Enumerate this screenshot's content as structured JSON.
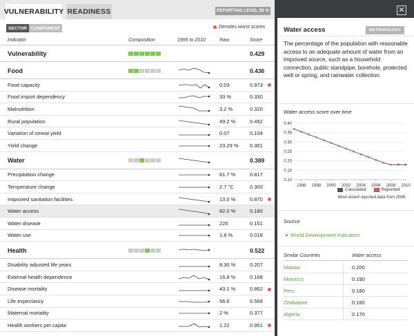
{
  "tabs": {
    "vulnerability": "VULNERABILITY",
    "readiness": "READINESS"
  },
  "reporting_badge": "REPORTING LEVEL 58 %",
  "toggles": {
    "sector": "SECTOR",
    "component": "COMPONENT"
  },
  "worst_note": "Denotes worst scores",
  "columns": {
    "indicator": "Indicator",
    "composition": "Composition",
    "period": "1995 to 2010",
    "raw": "Raw",
    "score": "Score"
  },
  "rows": [
    {
      "name": "Vulnerability",
      "type": "top",
      "raw": "",
      "score": "0.429",
      "comp": [
        1,
        1,
        1,
        1,
        1,
        1
      ],
      "spark": [],
      "worst": false
    },
    {
      "name": "Food",
      "type": "group",
      "raw": "",
      "score": "0.436",
      "comp": [
        1,
        1,
        0,
        0,
        0,
        0
      ],
      "spark": [
        6,
        4,
        6,
        3,
        5,
        9,
        10
      ],
      "worst": false
    },
    {
      "name": "Food capacity",
      "type": "item",
      "raw": "0.03",
      "score": "0.973",
      "comp": [],
      "spark": [
        7,
        6,
        6,
        7,
        6,
        11,
        6,
        10
      ],
      "worst": true
    },
    {
      "name": "Food import dependency",
      "type": "item",
      "raw": "33 %",
      "score": "0.330",
      "comp": [],
      "spark": [
        8,
        8,
        6,
        5,
        8,
        6,
        6
      ],
      "worst": false
    },
    {
      "name": "Malnutrition",
      "type": "item",
      "raw": "3.2 %",
      "score": "0.320",
      "comp": [],
      "spark": [
        2,
        3,
        4,
        5,
        9,
        9,
        9
      ],
      "worst": false
    },
    {
      "name": "Rural population",
      "type": "item",
      "raw": "49.2 %",
      "score": "0.492",
      "comp": [],
      "spark": [
        5,
        6,
        7,
        8,
        9,
        10,
        11
      ],
      "worst": false
    },
    {
      "name": "Variation of cereal yield",
      "type": "item",
      "raw": "0.07",
      "score": "0.104",
      "comp": [],
      "spark": [
        9,
        9,
        9,
        9,
        9,
        9,
        9
      ],
      "worst": false
    },
    {
      "name": "Yield change",
      "type": "item",
      "raw": "23.29 %",
      "score": "0.361",
      "comp": [],
      "spark": [
        7,
        7,
        7,
        7,
        7,
        7,
        7
      ],
      "worst": false
    },
    {
      "name": "Water",
      "type": "group",
      "raw": "",
      "score": "0.389",
      "comp": [
        0,
        0,
        1,
        0,
        0,
        0
      ],
      "spark": [
        4,
        5,
        6,
        7,
        8,
        9,
        10
      ],
      "worst": false
    },
    {
      "name": "Precipitation change",
      "type": "item",
      "raw": "81.7 %",
      "score": "0.817",
      "comp": [],
      "spark": [
        7,
        7,
        7,
        7,
        7,
        7,
        7
      ],
      "worst": false
    },
    {
      "name": "Temperature change",
      "type": "item",
      "raw": "2.7 °C",
      "score": "0.300",
      "comp": [],
      "spark": [
        7,
        7,
        7,
        7,
        7,
        7,
        7
      ],
      "worst": false
    },
    {
      "name": "Improved sanitation facilities",
      "type": "item",
      "raw": "13.0 %",
      "score": "0.870",
      "comp": [],
      "spark": [
        4,
        5,
        6,
        7,
        8,
        9,
        10
      ],
      "worst": true
    },
    {
      "name": "Water access",
      "type": "item",
      "raw": "82.0 %",
      "score": "0.180",
      "comp": [],
      "spark": [
        4,
        5,
        6,
        7,
        8,
        9,
        11
      ],
      "worst": false,
      "highlight": true
    },
    {
      "name": "Water disease",
      "type": "item",
      "raw": "226",
      "score": "0.151",
      "comp": [],
      "spark": [
        9,
        9,
        9,
        9,
        9,
        9,
        9
      ],
      "worst": false
    },
    {
      "name": "Water use",
      "type": "item",
      "raw": "1.8 %",
      "score": "0.018",
      "comp": [],
      "spark": [
        7,
        7,
        7,
        7,
        7,
        7,
        7
      ],
      "worst": false
    },
    {
      "name": "Health",
      "type": "group",
      "raw": "",
      "score": "0.522",
      "comp": [
        0,
        0,
        0,
        1,
        0,
        0
      ],
      "spark": [
        6,
        5,
        6,
        5,
        6,
        7,
        6
      ],
      "worst": false
    },
    {
      "name": "Disability adjusted life years",
      "type": "item",
      "raw": "8.30 %",
      "score": "0.207",
      "comp": [],
      "spark": [
        9,
        9,
        9,
        9,
        9,
        9,
        9
      ],
      "worst": false
    },
    {
      "name": "External health dependence",
      "type": "item",
      "raw": "16.8 %",
      "score": "0.168",
      "comp": [],
      "spark": [
        9,
        7,
        8,
        4,
        9,
        7,
        10
      ],
      "worst": false
    },
    {
      "name": "Disease mortality",
      "type": "item",
      "raw": "43.1 %",
      "score": "0.862",
      "comp": [],
      "spark": [
        9,
        9,
        9,
        9,
        9,
        9,
        9
      ],
      "worst": true
    },
    {
      "name": "Life expectancy",
      "type": "item",
      "raw": "56.6",
      "score": "0.568",
      "comp": [],
      "spark": [
        7,
        7,
        7,
        8,
        8,
        8,
        7
      ],
      "worst": false
    },
    {
      "name": "Maternal mortality",
      "type": "item",
      "raw": "2 %",
      "score": "0.377",
      "comp": [],
      "spark": [
        7,
        7,
        7,
        7,
        7,
        7,
        7
      ],
      "worst": false
    },
    {
      "name": "Health workers per capita",
      "type": "item",
      "raw": "1.22",
      "score": "0.951",
      "comp": [],
      "spark": [
        8,
        8,
        8,
        4,
        9,
        8,
        9
      ],
      "worst": true
    }
  ],
  "detail": {
    "title": "Water access",
    "methodology": "METHODOLOGY",
    "description": "The percentage of the population with reasonable access to an adequate amount of water from an improved source, such as a household connection, public standpipe, borehole, protected well or spring, and rainwater collection.",
    "chart_title": "Water access score over time",
    "legend": {
      "calculated": "Calculated",
      "reported": "Reported"
    },
    "recent_note": "Most recent reported data from 2008",
    "source_label": "Source",
    "source_item": "World Development Indicators",
    "similar_header": {
      "country": "Similar Countries",
      "value": "Water access"
    },
    "similar": [
      {
        "country": "Malawi",
        "value": "0.200"
      },
      {
        "country": "Morocco",
        "value": "0.190"
      },
      {
        "country": "Peru",
        "value": "0.180"
      },
      {
        "country": "Zimbabwe",
        "value": "0.180"
      },
      {
        "country": "Algeria",
        "value": "0.170"
      }
    ]
  },
  "chart_data": {
    "type": "line",
    "title": "Water access score over time",
    "xlabel": "",
    "ylabel": "",
    "x": [
      1995,
      1996,
      1997,
      1998,
      1999,
      2000,
      2001,
      2002,
      2003,
      2004,
      2005,
      2006,
      2007,
      2008,
      2009,
      2010
    ],
    "series": [
      {
        "name": "Calculated",
        "values": [
          0.37,
          0.355,
          0.34,
          0.325,
          0.31,
          0.295,
          0.28,
          0.265,
          0.25,
          0.235,
          0.22,
          0.205,
          0.19,
          0.18,
          0.18,
          0.18
        ]
      }
    ],
    "reported_x": [
      1995,
      1996,
      1997,
      1998,
      1999,
      2000,
      2001,
      2002,
      2003,
      2004,
      2005,
      2006,
      2007,
      2008
    ],
    "xticks": [
      1996,
      1998,
      2000,
      2002,
      2004,
      2006,
      2008,
      2010
    ],
    "yticks": [
      0.1,
      0.15,
      0.2,
      0.25,
      0.3,
      0.35,
      0.4
    ],
    "xlim": [
      1995,
      2010
    ],
    "ylim": [
      0.1,
      0.4
    ],
    "colors": {
      "calculated": "#555555",
      "reported": "#e05a5a"
    },
    "grid": true,
    "legend": "bottom"
  }
}
